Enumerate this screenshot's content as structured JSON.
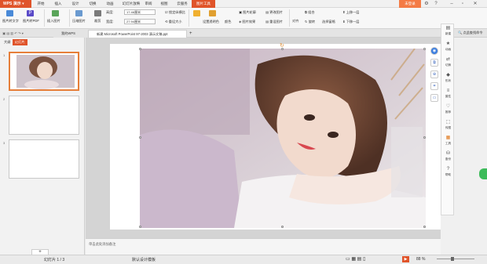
{
  "title_bar": {
    "app_name": "WPS 演示",
    "menus": [
      "开始",
      "插入",
      "设计",
      "切换",
      "动画",
      "幻灯片放映",
      "审阅",
      "视图",
      "云服务",
      "图片工具"
    ],
    "active_menu": "图片工具",
    "login_label": "未登录"
  },
  "ribbon": {
    "img_to_text": "图片转文字",
    "img_to_pdf": "图片转PDF",
    "insert_img": "插入图片",
    "compress_img": "压缩图片",
    "crop": "裁剪",
    "height_label": "高度:",
    "height_value": "17.46厘米",
    "width_label": "宽度:",
    "width_value": "27.94厘米",
    "lock_ratio": "锁定纵横比",
    "reset_size": "重设大小",
    "set_transparent": "设置透明色",
    "color": "颜色",
    "img_outline": "图片轮廓",
    "img_effect": "图片效果",
    "change_img": "更改图片",
    "reset_img": "重设图片",
    "align": "对齐",
    "combine": "组合",
    "rotate": "旋转",
    "select_pane": "选择窗格",
    "bring_forward": "上移一层",
    "send_backward": "下移一层"
  },
  "tabs": {
    "my_wps": "我的WPS",
    "doc_name": "新建 Microsoft PowerPoint 97-2003 演示文稿.ppt"
  },
  "left_panel": {
    "tab_outline": "大纲",
    "tab_slides": "幻灯片",
    "slide_numbers": [
      "1",
      "2",
      "3"
    ]
  },
  "right_panel": {
    "search_placeholder": "点此查找命令",
    "items": [
      "新建",
      "动画",
      "切换",
      "形状",
      "属性",
      "推荐",
      "传图",
      "工具",
      "备份",
      "帮助"
    ]
  },
  "notes": {
    "placeholder": "单击此处添加备注"
  },
  "status_bar": {
    "slide_info": "幻灯片 1 / 3",
    "template": "默认设计模板",
    "zoom": "88 %"
  },
  "colors": {
    "accent": "#e0542a",
    "login": "#f47b45"
  }
}
